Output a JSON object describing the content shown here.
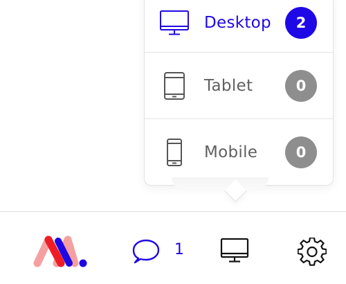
{
  "device_menu": {
    "items": [
      {
        "label": "Desktop",
        "count": "2",
        "icon": "desktop-icon",
        "active": true
      },
      {
        "label": "Tablet",
        "count": "0",
        "icon": "tablet-icon",
        "active": false
      },
      {
        "label": "Mobile",
        "count": "0",
        "icon": "mobile-icon",
        "active": false
      }
    ]
  },
  "tabbar": {
    "comments_count": "1",
    "icons": {
      "logo": "brand-logo",
      "comments": "chat-bubble-icon",
      "device": "desktop-icon",
      "settings": "gear-icon"
    }
  },
  "colors": {
    "accent": "#1f08e6",
    "inactive_badge": "#8e8e8e",
    "text_inactive": "#606060",
    "logo_pink": "#f5a0a0",
    "logo_red": "#ee1c25",
    "logo_blue": "#1f08e6"
  }
}
